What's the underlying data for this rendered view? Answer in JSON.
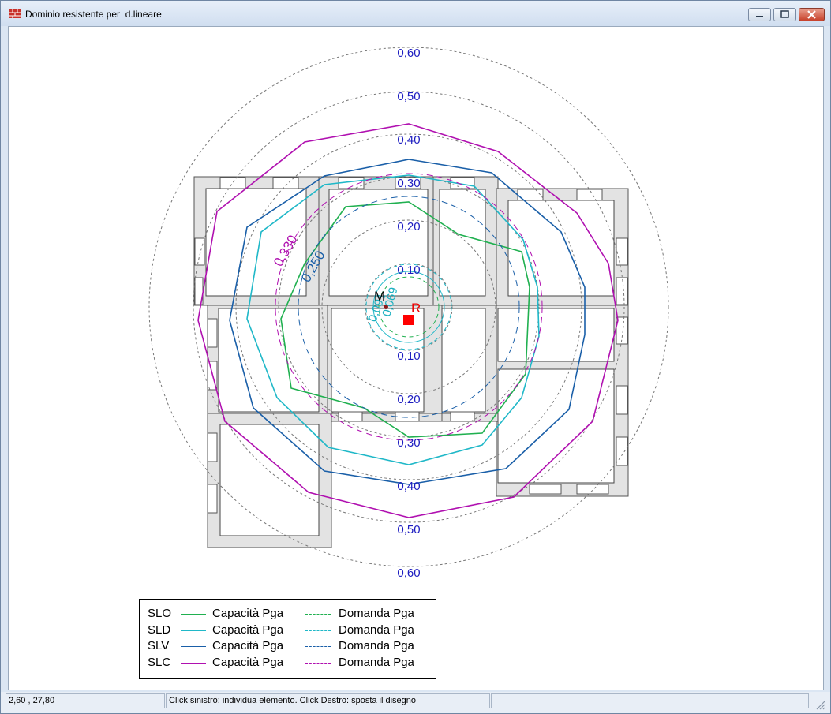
{
  "window": {
    "title": "Dominio resistente per  d.lineare"
  },
  "plot": {
    "ring_labels_top": [
      "0,60",
      "0,50",
      "0,40",
      "0,30",
      "0,20",
      "0,10"
    ],
    "ring_labels_bottom": [
      "0,10",
      "0,20",
      "0,30",
      "0,40",
      "0,50",
      "0,60"
    ],
    "ring_label_color": "#1c1cc0",
    "marker_m": "M",
    "marker_r": "R",
    "contour_labels": [
      {
        "text": "0,330",
        "color": "#b010b0"
      },
      {
        "text": "0,250",
        "color": "#1a5fa8"
      },
      {
        "text": "0,091",
        "color": "#1cb0c0"
      },
      {
        "text": "0,069",
        "color": "#1cb0c0"
      }
    ],
    "colors": {
      "slo": "#20b050",
      "sld": "#20b8c8",
      "slv": "#1a5fa8",
      "slc": "#b010b0",
      "wall": "#e3e3e3"
    }
  },
  "legend": {
    "rows": [
      {
        "name": "SLO",
        "capacity": "Capacità Pga",
        "demand": "Domanda Pga",
        "color": "#20b050"
      },
      {
        "name": "SLD",
        "capacity": "Capacità Pga",
        "demand": "Domanda Pga",
        "color": "#20b8c8"
      },
      {
        "name": "SLV",
        "capacity": "Capacità Pga",
        "demand": "Domanda Pga",
        "color": "#1a5fa8"
      },
      {
        "name": "SLC",
        "capacity": "Capacità Pga",
        "demand": "Domanda Pga",
        "color": "#b010b0"
      }
    ]
  },
  "statusbar": {
    "coords": "2,60 , 27,80",
    "hint": "Click sinistro: individua elemento. Click Destro: sposta il disegno",
    "extra": ""
  }
}
